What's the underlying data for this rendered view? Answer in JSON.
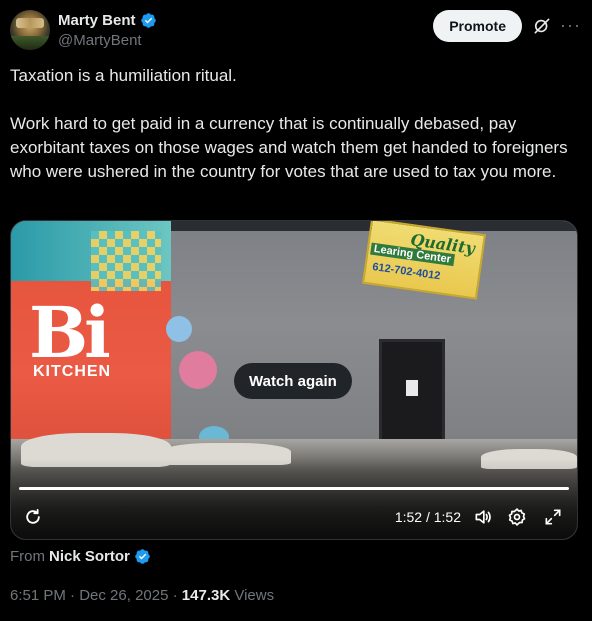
{
  "author": {
    "display_name": "Marty Bent",
    "handle": "@MartyBent"
  },
  "header": {
    "promote_label": "Promote",
    "more_glyph": "···"
  },
  "tweet": {
    "paragraphs": [
      "Taxation is a humiliation ritual.",
      "Work hard to get paid in a currency that is continually debased, pay exorbitant taxes on those wages and watch them get handed to foreigners who were ushered in the country for votes that are used to tax you more."
    ]
  },
  "video": {
    "watch_again_label": "Watch again",
    "time": "1:52 / 1:52",
    "progress": 1.0,
    "scene_text": {
      "mural_big": "Bi",
      "mural_kitchen": "KITCHEN",
      "sign_line1": "Quality",
      "sign_line2": "Learing Center",
      "sign_phone": "612-702-4012"
    }
  },
  "source": {
    "prefix": "From",
    "name": "Nick Sortor"
  },
  "meta": {
    "time": "6:51 PM",
    "date": "Dec 26, 2025",
    "views_count": "147.3K",
    "views_label": "Views",
    "separator": "·"
  },
  "colors": {
    "background": "#000000",
    "text": "#e7e9ea",
    "muted": "#71767b",
    "verified": "#1d9bf0"
  },
  "icons": [
    "verified-badge-icon",
    "grok-icon",
    "more-icon",
    "replay-icon",
    "volume-icon",
    "settings-icon",
    "fullscreen-icon"
  ]
}
